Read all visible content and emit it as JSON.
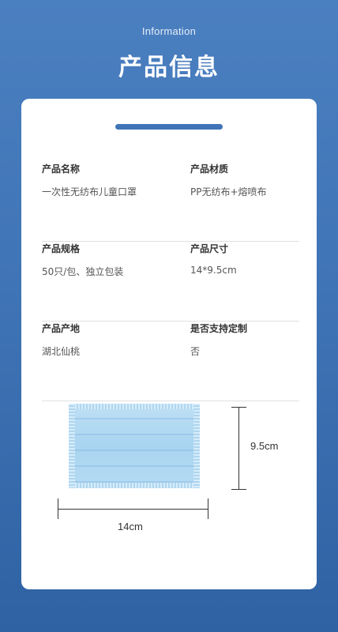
{
  "header": {
    "subtitle": "Information",
    "title": "产品信息"
  },
  "rows": [
    {
      "left": {
        "label": "产品名称",
        "value": "一次性无纺布儿童口罩"
      },
      "right": {
        "label": "产品材质",
        "value": "PP无纺布+熔喷布"
      }
    },
    {
      "left": {
        "label": "产品规格",
        "value": "50只/包、独立包装"
      },
      "right": {
        "label": "产品尺寸",
        "value": "14*9.5cm"
      }
    },
    {
      "left": {
        "label": "产品产地",
        "value": "湖北仙桃"
      },
      "right": {
        "label": "是否支持定制",
        "value": "否"
      }
    }
  ],
  "dimensions": {
    "height_label": "9.5cm",
    "width_label": "14cm"
  },
  "colors": {
    "accent": "#3f74b6",
    "background": "#3f74b6",
    "mask": "#a9d4f0"
  }
}
